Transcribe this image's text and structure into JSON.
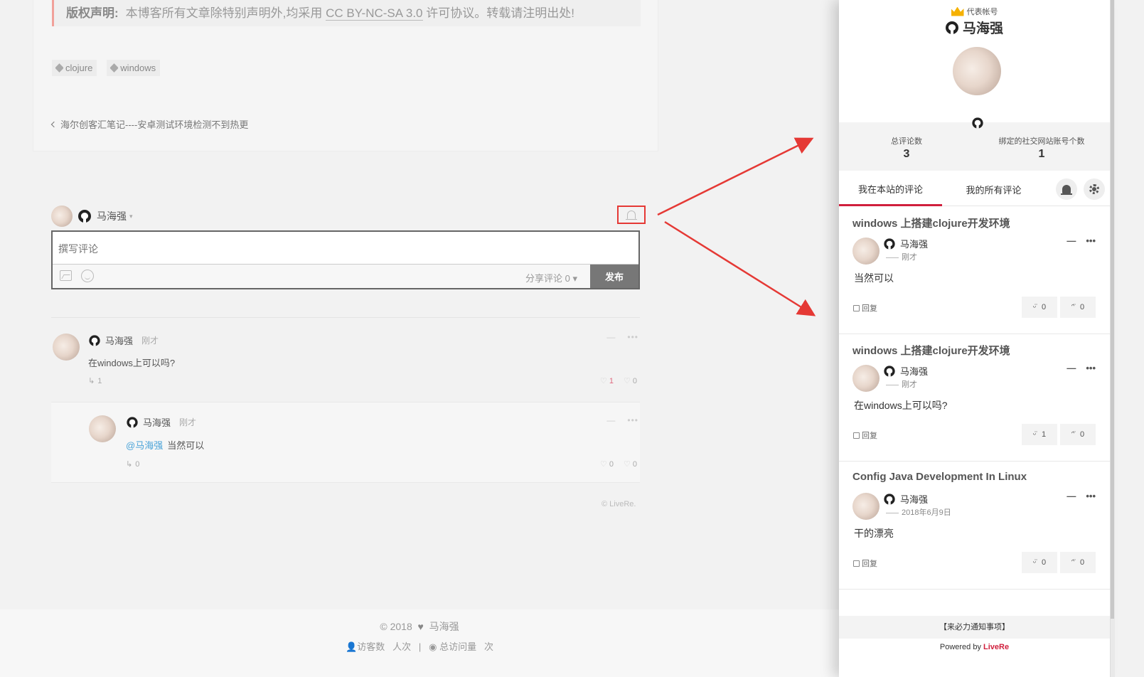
{
  "post": {
    "copyright_label": "版权声明:",
    "copyright_text_before": "本博客所有文章除特别声明外,均采用",
    "copyright_license": "CC BY-NC-SA 3.0",
    "copyright_text_after": "许可协议。转载请注明出处!",
    "tags": [
      "clojure",
      "windows"
    ],
    "prev_post": "海尔创客汇笔记----安卓测试环境检测不到热更"
  },
  "comment_box": {
    "user_name": "马海强",
    "placeholder": "撰写评论",
    "share_label": "分享评论 0 ▾",
    "publish_label": "发布"
  },
  "comments": [
    {
      "user": "马海强",
      "time": "刚才",
      "text": "在windows上可以吗?",
      "replies": "1",
      "likes": "1",
      "dislikes": "0"
    },
    {
      "user": "马海强",
      "time": "刚才",
      "mention": "@马海强",
      "text": "当然可以",
      "replies": "0",
      "likes": "0",
      "dislikes": "0"
    }
  ],
  "livere_small": "© LiveRe.",
  "footer": {
    "copyright": "© 2018",
    "author": "马海强",
    "visitors_label": "访客数",
    "visitors_unit": "人次",
    "pv_label": "总访问量",
    "pv_unit": "次"
  },
  "panel": {
    "rep_label": "代表帐号",
    "name": "马海强",
    "stats": [
      {
        "label": "总评论数",
        "value": "3"
      },
      {
        "label": "绑定的社交网站账号个数",
        "value": "1"
      }
    ],
    "tabs": [
      "我在本站的评论",
      "我的所有评论"
    ],
    "items": [
      {
        "title": "windows 上搭建clojure开发环境",
        "user": "马海强",
        "time": "刚才",
        "body": "当然可以",
        "reply": "回复",
        "up": "0",
        "down": "0"
      },
      {
        "title": "windows 上搭建clojure开发环境",
        "user": "马海强",
        "time": "刚才",
        "body": "在windows上可以吗?",
        "reply": "回复",
        "up": "1",
        "down": "0"
      },
      {
        "title": "Config Java Development In Linux",
        "user": "马海强",
        "time": "2018年6月9日",
        "body": "干的漂亮",
        "reply": "回复",
        "up": "0",
        "down": "0"
      }
    ],
    "notice": "【来必力通知事项】",
    "powered_prefix": "Powered by ",
    "powered_brand": "LiveRe"
  },
  "colors": {
    "accent_red": "#d01f3c",
    "annotation_red": "#e53935",
    "mention_blue": "#4aa3d8"
  }
}
